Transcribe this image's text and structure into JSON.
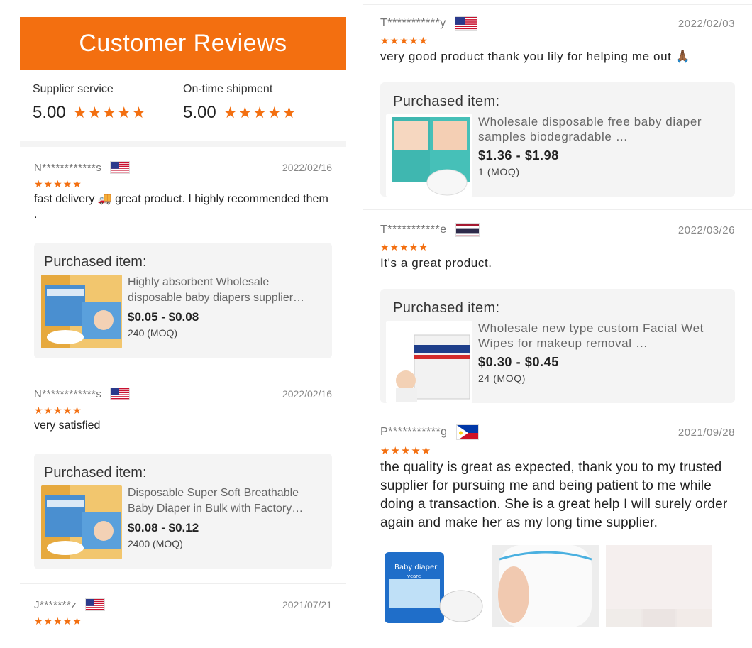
{
  "header": {
    "title": "Customer Reviews"
  },
  "summary": [
    {
      "label": "Supplier service",
      "score": "5.00",
      "stars": "★★★★★"
    },
    {
      "label": "On-time shipment",
      "score": "5.00",
      "stars": "★★★★★"
    }
  ],
  "left_reviews": [
    {
      "name": "N************s",
      "country": "us-flag-icon",
      "date": "2022/02/16",
      "stars": "★★★★★",
      "text": "fast delivery 🚚 great product. I highly recommended them .",
      "purchase_title": "Purchased item:",
      "product": "Highly absorbent Wholesale disposable baby diapers supplier…",
      "price": "$0.05 - $0.08",
      "moq": "240 (MOQ)"
    },
    {
      "name": "N************s",
      "country": "us-flag-icon",
      "date": "2022/02/16",
      "stars": "★★★★★",
      "text": "very satisfied",
      "purchase_title": "Purchased item:",
      "product": "Disposable Super Soft Breathable Baby Diaper in Bulk with Factory…",
      "price": "$0.08 - $0.12",
      "moq": "2400 (MOQ)"
    },
    {
      "name": "J*******z",
      "country": "us-flag-icon",
      "date": "2021/07/21",
      "stars": "★★★★★"
    }
  ],
  "right_reviews": [
    {
      "name": "T***********y",
      "country": "us-flag-icon",
      "date": "2022/02/03",
      "stars": "★★★★★",
      "text": "very good  product  thank you lily for helping me out 🙏🏾",
      "purchase_title": "Purchased item:",
      "product": "Wholesale disposable free baby diaper samples biodegradable …",
      "price": "$1.36 - $1.98",
      "moq": "1 (MOQ)"
    },
    {
      "name": "T***********e",
      "country": "thailand-flag-icon",
      "date": "2022/03/26",
      "stars": "★★★★★",
      "text": "It's a great product.",
      "purchase_title": "Purchased item:",
      "product": "Wholesale new type custom Facial Wet Wipes for makeup removal …",
      "price": "$0.30 - $0.45",
      "moq": "24 (MOQ)"
    },
    {
      "name": "P***********g",
      "country": "philippines-flag-icon",
      "date": "2021/09/28",
      "stars": "★★★★★",
      "text": "the quality is great as expected, thank you to my trusted supplier for pursuing me and being patient to me while doing a transaction. She is a great help I will surely order again and make her as my long time supplier.",
      "photo_labels": [
        "Baby diaper",
        "vcare"
      ]
    }
  ],
  "colors": {
    "accent": "#f36f10",
    "panel": "#f4f4f4"
  }
}
